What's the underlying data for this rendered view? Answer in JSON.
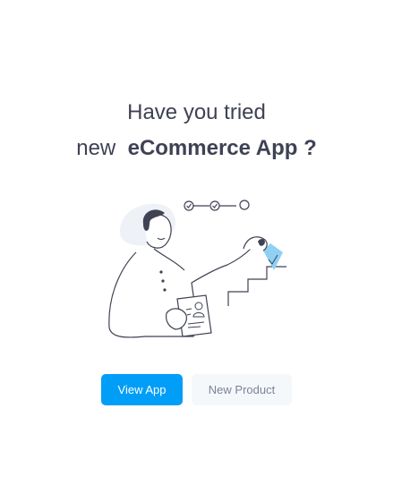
{
  "headline": {
    "line1": "Have you tried",
    "line2_prefix": "new",
    "line2_strong": "eCommerce App ?"
  },
  "illustration": {
    "icon": "person-with-checklist-and-stairs-illustration",
    "colors": {
      "stroke": "#3f4254",
      "blob": "#eef1f6",
      "accent": "#8fd0f5"
    }
  },
  "actions": {
    "primary_label": "View App",
    "secondary_label": "New Product"
  },
  "colors": {
    "primary": "#009ef7",
    "light": "#f5f8fa",
    "text": "#3f4254"
  }
}
